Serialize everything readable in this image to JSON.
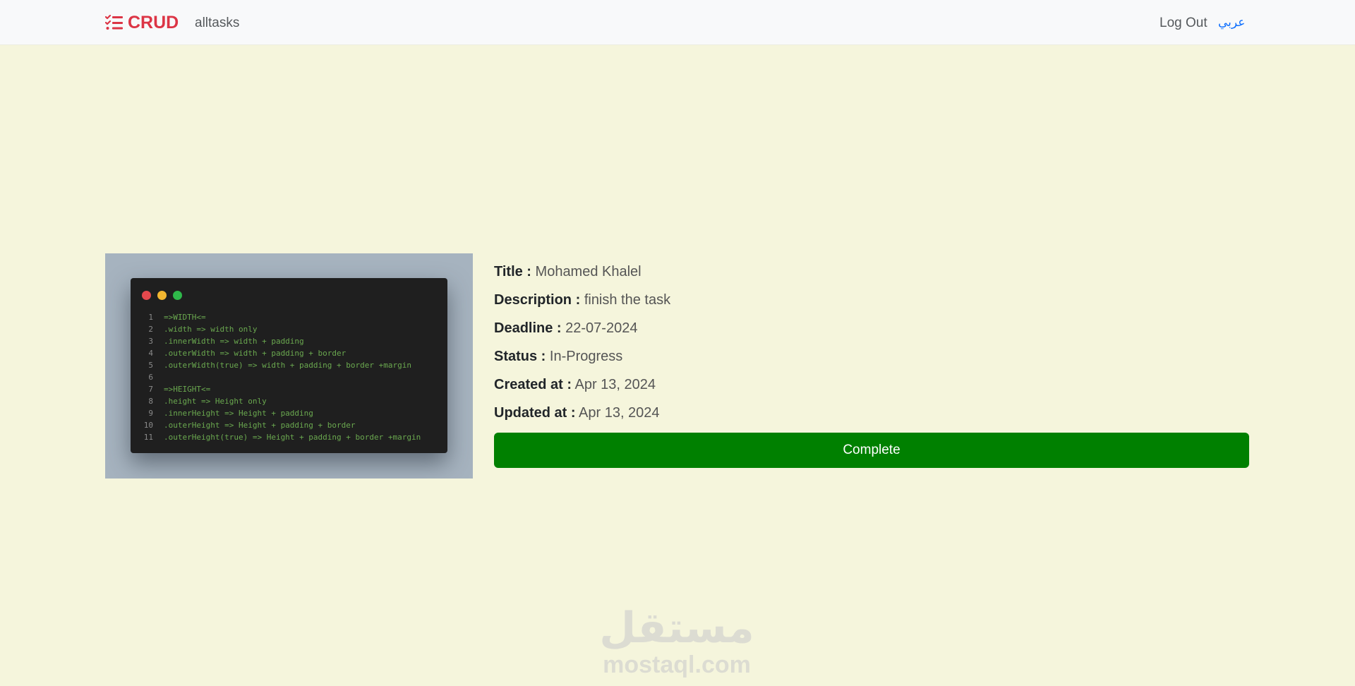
{
  "navbar": {
    "brand_icon": "list-check-icon",
    "brand_label": "CRUD",
    "brand_color": "#dc3545",
    "links": [
      {
        "label": "alltasks"
      }
    ],
    "logout_label": "Log Out",
    "language_label": "عربي"
  },
  "task": {
    "image_code_lines": [
      {
        "num": "1",
        "text": "=>WIDTH<="
      },
      {
        "num": "2",
        "text": ".width => width only"
      },
      {
        "num": "3",
        "text": ".innerWidth => width + padding"
      },
      {
        "num": "4",
        "text": ".outerWidth => width + padding + border"
      },
      {
        "num": "5",
        "text": ".outerWidth(true) => width + padding + border +margin"
      },
      {
        "num": "6",
        "text": ""
      },
      {
        "num": "7",
        "text": "=>HEIGHT<="
      },
      {
        "num": "8",
        "text": ".height => Height only"
      },
      {
        "num": "9",
        "text": ".innerHeight => Height + padding"
      },
      {
        "num": "10",
        "text": ".outerHeight => Height + padding + border"
      },
      {
        "num": "11",
        "text": ".outerHeight(true) => Height + padding + border +margin"
      }
    ],
    "fields": [
      {
        "label": "Title :",
        "value": "Mohamed Khalel"
      },
      {
        "label": "Description :",
        "value": "finish the task"
      },
      {
        "label": "Deadline :",
        "value": "22-07-2024"
      },
      {
        "label": "Status :",
        "value": "In-Progress"
      },
      {
        "label": "Created at :",
        "value": "Apr 13, 2024"
      },
      {
        "label": "Updated at :",
        "value": "Apr 13, 2024"
      }
    ],
    "complete_label": "Complete",
    "complete_color": "#008000"
  },
  "watermark": {
    "arabic": "مستقل",
    "latin": "mostaql.com"
  }
}
